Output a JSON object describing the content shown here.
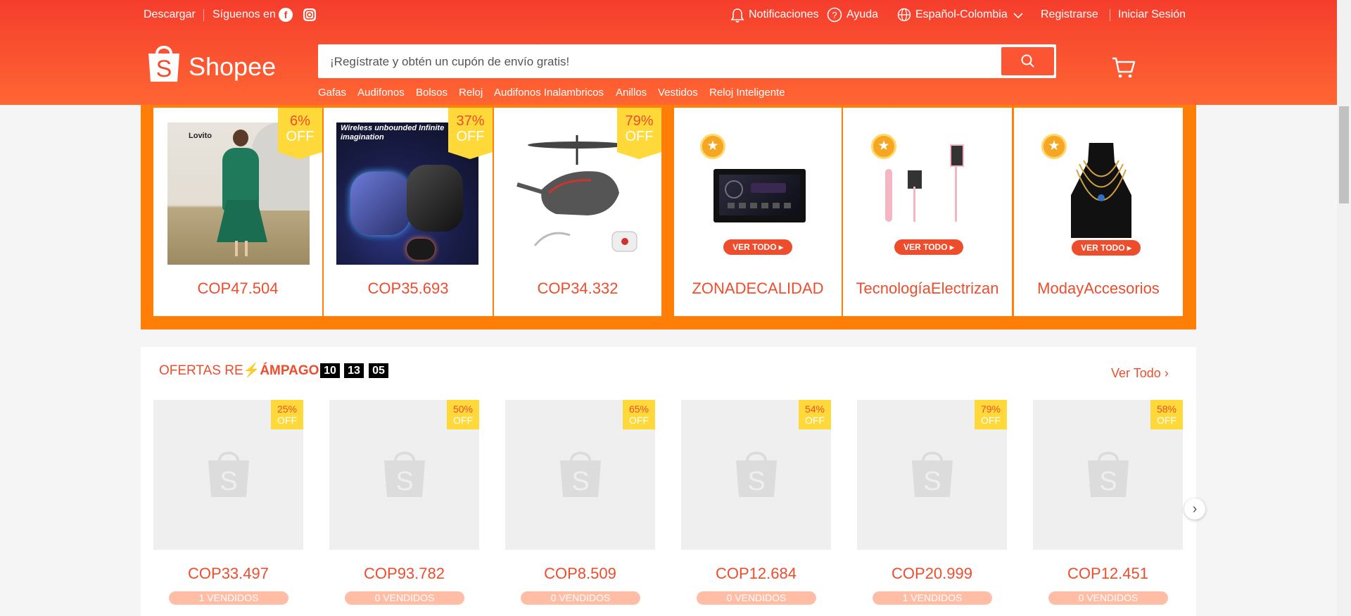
{
  "topbar": {
    "download": "Descargar",
    "follow": "Síguenos en",
    "notifications": "Notificaciones",
    "help": "Ayuda",
    "language": "Español-Colombia",
    "register": "Registrarse",
    "login": "Iniciar Sesión"
  },
  "header": {
    "logo_text": "Shopee",
    "search_placeholder": "¡Regístrate y obtén un cupón de envío gratis!",
    "hotwords": [
      "Gafas",
      "Audifonos",
      "Bolsos",
      "Reloj",
      "Audifonos Inalambricos",
      "Anillos",
      "Vestidos",
      "Reloj Inteligente"
    ]
  },
  "banner": {
    "products": [
      {
        "discount": "6%",
        "off": "OFF",
        "price": "COP47.504",
        "brand": "Lovito"
      },
      {
        "discount": "37%",
        "off": "OFF",
        "price": "COP35.693",
        "image_title": "Wireless unbounded Infinite imagination"
      },
      {
        "discount": "79%",
        "off": "OFF",
        "price": "COP34.332"
      }
    ],
    "shops": [
      {
        "name": "ZONADECALIDAD",
        "cta": "VER TODO ▸"
      },
      {
        "name": "TecnologíaElectrizan",
        "cta": "VER TODO ▸"
      },
      {
        "name": "ModayAccesorios",
        "cta": "VER TODO ▸"
      }
    ]
  },
  "flash_sale": {
    "title_part1": "OFERTAS RE",
    "title_part2": "ÁMPAGO",
    "timer": [
      "10",
      "13",
      "05"
    ],
    "see_all": "Ver Todo",
    "items": [
      {
        "discount": "25%",
        "off": "OFF",
        "price": "COP33.497",
        "sold": "1 VENDIDOS"
      },
      {
        "discount": "50%",
        "off": "OFF",
        "price": "COP93.782",
        "sold": "0 VENDIDOS"
      },
      {
        "discount": "65%",
        "off": "OFF",
        "price": "COP8.509",
        "sold": "0 VENDIDOS"
      },
      {
        "discount": "54%",
        "off": "OFF",
        "price": "COP12.684",
        "sold": "0 VENDIDOS"
      },
      {
        "discount": "79%",
        "off": "OFF",
        "price": "COP20.999",
        "sold": "1 VENDIDOS"
      },
      {
        "discount": "58%",
        "off": "OFF",
        "price": "COP12.451",
        "sold": "0 VENDIDOS"
      }
    ]
  },
  "colors": {
    "brand": "#ee4d2d",
    "banner_bg": "#ff7e08",
    "badge": "#ffd839"
  }
}
